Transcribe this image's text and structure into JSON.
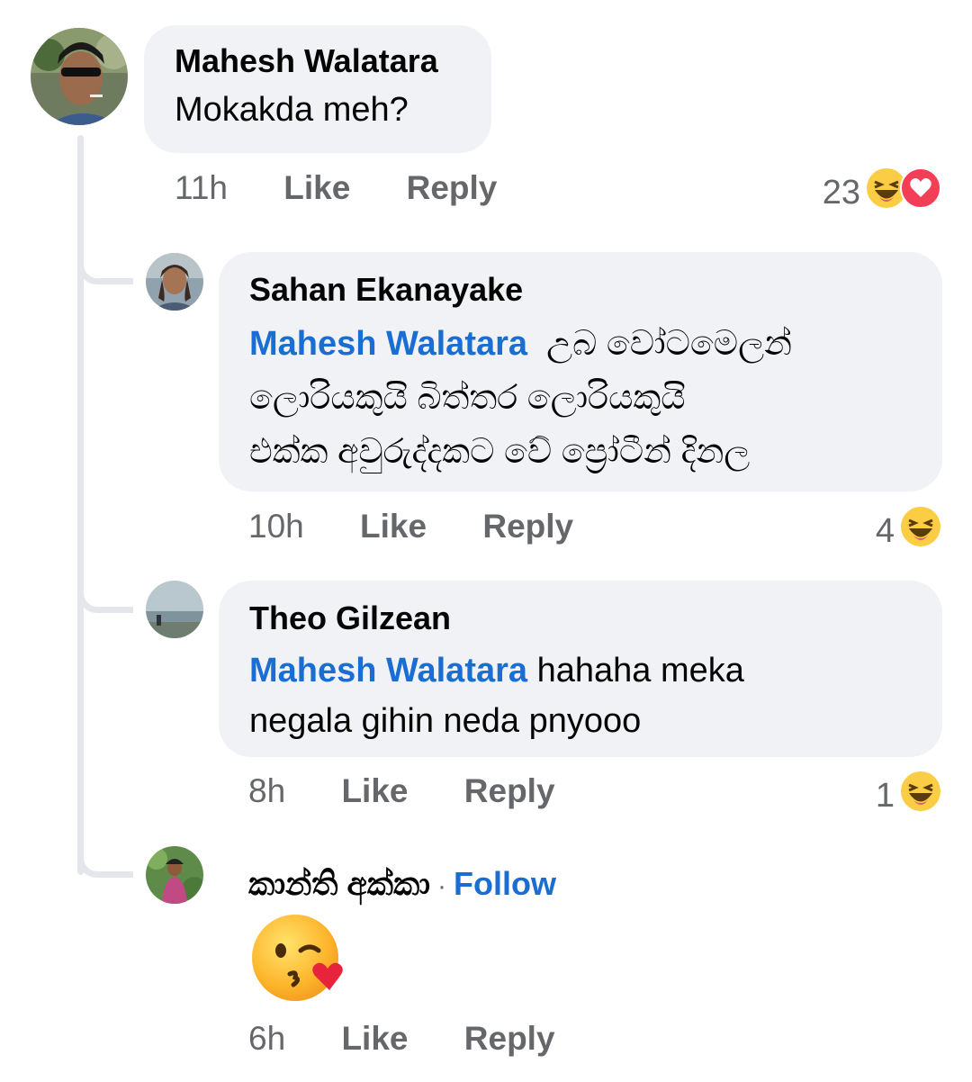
{
  "comments": [
    {
      "author": "Mahesh Walatara",
      "text": "Mokakda meh?",
      "time": "11h",
      "like": "Like",
      "reply": "Reply",
      "reaction_count": "23",
      "reactions": [
        "haha-icon",
        "love-icon"
      ]
    },
    {
      "author": "Sahan Ekanayake",
      "mention": "Mahesh Walatara",
      "text_line1": "උබ වෝටමෙලන්",
      "text_line2": "ලොරියකුයි බිත්තර ලොරියකුයි",
      "text_line3": "එක්ක අවුරුද්දකට වේ ප්‍රෝටීන් දිනල",
      "time": "10h",
      "like": "Like",
      "reply": "Reply",
      "reaction_count": "4",
      "reactions": [
        "haha-icon"
      ]
    },
    {
      "author": "Theo Gilzean",
      "mention": "Mahesh Walatara",
      "text_line1": "hahaha meka",
      "text_line2": "negala gihin neda pnyooo",
      "time": "8h",
      "like": "Like",
      "reply": "Reply",
      "reaction_count": "1",
      "reactions": [
        "haha-icon"
      ]
    },
    {
      "author": "කාන්ති අක්කා",
      "separator": "·",
      "follow": "Follow",
      "sticker": "kissing-heart-emoji",
      "time": "6h",
      "like": "Like",
      "reply": "Reply"
    }
  ],
  "colors": {
    "bubble": "#f0f2f5",
    "mention": "#1b6ed1",
    "meta": "#65676b",
    "thread": "#e4e6eb"
  }
}
